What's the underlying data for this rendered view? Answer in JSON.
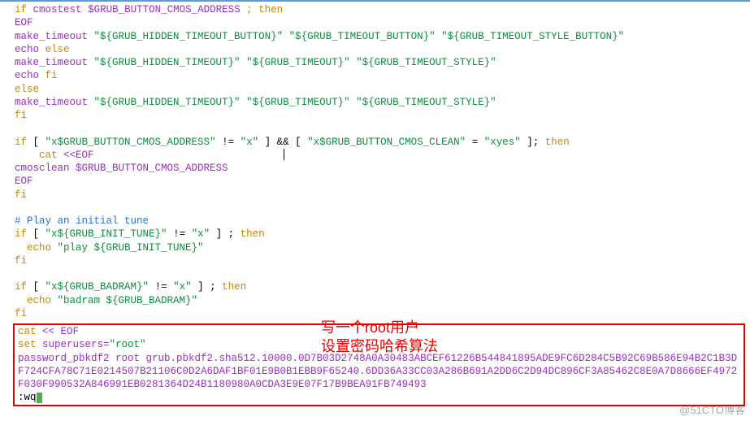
{
  "code": {
    "l01_if": "if",
    "l01_fn": "cmostest",
    "l01_var": "$GRUB_BUTTON_CMOS_ADDRESS",
    "l01_then": " ; then",
    "l02": "EOF",
    "l03_fn": "make_timeout ",
    "l03_s1": "\"${GRUB_HIDDEN_TIMEOUT_BUTTON}\"",
    "l03_s2": "\"${GRUB_TIMEOUT_BUTTON}\"",
    "l03_s3": "\"${GRUB_TIMEOUT_STYLE_BUTTON}\"",
    "l04_fn": "echo ",
    "l04_kw": "else",
    "l05_fn": "make_timeout ",
    "l05_s1": "\"${GRUB_HIDDEN_TIMEOUT}\"",
    "l05_s2": "\"${GRUB_TIMEOUT}\"",
    "l05_s3": "\"${GRUB_TIMEOUT_STYLE}\"",
    "l06_fn": "echo ",
    "l06_kw": "fi",
    "l07": "else",
    "l08_fn": "make_timeout ",
    "l08_s1": "\"${GRUB_HIDDEN_TIMEOUT}\"",
    "l08_s2": "\"${GRUB_TIMEOUT}\"",
    "l08_s3": "\"${GRUB_TIMEOUT_STYLE}\"",
    "l09": "fi",
    "l11_if": "if",
    "l11_b1": " [ ",
    "l11_s1": "\"x$GRUB_BUTTON_CMOS_ADDRESS\"",
    "l11_ne": " != ",
    "l11_s2": "\"x\"",
    "l11_b2": " ] ",
    "l11_and": "&&",
    "l11_b3": " [ ",
    "l11_s3": "\"x$GRUB_BUTTON_CMOS_CLEAN\"",
    "l11_eq": " = ",
    "l11_s4": "\"xyes\"",
    "l11_b4": " ]; ",
    "l11_then": "then",
    "l12_cat": "    cat ",
    "l12_here": "<<EOF",
    "l13_a": "cmosclean ",
    "l13_b": "$GRUB_BUTTON_CMOS_ADDRESS",
    "l14": "EOF",
    "l15": "fi",
    "l17": "# Play an initial tune",
    "l18_if": "if",
    "l18_b1": " [ ",
    "l18_s1": "\"x${GRUB_INIT_TUNE}\"",
    "l18_ne": " != ",
    "l18_s2": "\"x\"",
    "l18_b2": " ] ; ",
    "l18_then": "then",
    "l19_echo": "  echo ",
    "l19_s": "\"play ${GRUB_INIT_TUNE}\"",
    "l20": "fi",
    "l22_if": "if",
    "l22_b1": " [ ",
    "l22_s1": "\"x${GRUB_BADRAM}\"",
    "l22_ne": " != ",
    "l22_s2": "\"x\"",
    "l22_b2": " ] ; ",
    "l22_then": "then",
    "l23_echo": "  echo ",
    "l23_s": "\"badram ${GRUB_BADRAM}\"",
    "l24": "fi"
  },
  "box": {
    "l1_cat": "cat ",
    "l1_here": "<< EOF",
    "l2_set": "set ",
    "l2_var": "superusers=",
    "l2_val": "\"root\"",
    "l3": "password_pbkdf2 root grub.pbkdf2.sha512.10000.0D7B03D2748A0A30483ABCEF61226B544841895ADE9FC6D284C5B92C69B586E94B2C1B3DF724CFA78C71E0214507B21106C0D2A6DAF1BF01E9B0B1EBB9F65240.6DD36A33CC03A286B691A2DD6C2D94DC896CF3A85462C8E0A7D8666EF4972F030F990532A846991EB0281364D24B1180980A0CDA3E9E07F17B9BEA91FB749493",
    "l4": ":wq"
  },
  "annotation": {
    "line1": "写一个root用户",
    "line2": "设置密码哈希算法"
  },
  "watermark": "@51CTO博客"
}
